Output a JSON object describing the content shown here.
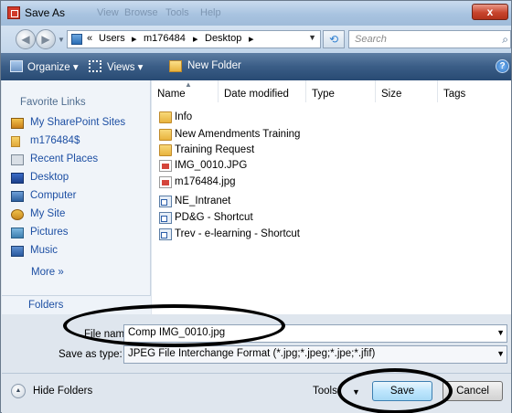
{
  "window": {
    "title": "Save As",
    "close_label": "x",
    "ghost_menu": [
      "View",
      "Browse",
      "Tools",
      "Help"
    ]
  },
  "nav": {
    "back_glyph": "◀",
    "forward_glyph": "▶",
    "breadcrumbs": [
      "«",
      "Users",
      "▸",
      "m176484",
      "▸",
      "Desktop",
      "▸"
    ],
    "search_placeholder": "Search",
    "refresh_glyph": "⟲"
  },
  "toolbar": {
    "organize_label": "Organize ▾",
    "views_label": "Views ▾",
    "new_folder_label": "New Folder",
    "help_label": "?"
  },
  "left_pane": {
    "header": "Favorite Links",
    "items": [
      {
        "label": "My SharePoint Sites",
        "icon": "sharepoint-icon"
      },
      {
        "label": "m176484$",
        "icon": "user-folder-icon"
      },
      {
        "label": "Recent Places",
        "icon": "recent-places-icon"
      },
      {
        "label": "Desktop",
        "icon": "desktop-icon"
      },
      {
        "label": "Computer",
        "icon": "computer-icon"
      },
      {
        "label": "My Site",
        "icon": "my-site-icon"
      },
      {
        "label": "Pictures",
        "icon": "pictures-icon"
      },
      {
        "label": "Music",
        "icon": "music-icon"
      }
    ],
    "more_label": "More »",
    "folders_label": "Folders"
  },
  "file_list": {
    "columns": [
      "Name",
      "Date modified",
      "Type",
      "Size",
      "Tags"
    ],
    "files": [
      {
        "name": "Info",
        "kind": "folder"
      },
      {
        "name": "New Amendments Training",
        "kind": "folder"
      },
      {
        "name": "Training Request",
        "kind": "folder"
      },
      {
        "name": "IMG_0010.JPG",
        "kind": "jpg"
      },
      {
        "name": "m176484.jpg",
        "kind": "jpg"
      },
      {
        "name": "NE_Intranet",
        "kind": "shortcut"
      },
      {
        "name": "PD&G - Shortcut",
        "kind": "shortcut"
      },
      {
        "name": "Trev - e-learning - Shortcut",
        "kind": "shortcut"
      }
    ]
  },
  "form": {
    "file_name_label": "File name:",
    "file_name_value": "Comp IMG_0010.jpg",
    "save_type_label": "Save as type:",
    "save_type_value": "JPEG File Interchange Format (*.jpg;*.jpeg;*.jpe;*.jfif)"
  },
  "footer": {
    "hide_folders_label": "Hide Folders",
    "tools_label": "Tools",
    "save_label": "Save",
    "cancel_label": "Cancel"
  },
  "colors": {
    "toolbar": "#3a5d86",
    "link": "#1d4fa3",
    "annotation": "#000000"
  }
}
